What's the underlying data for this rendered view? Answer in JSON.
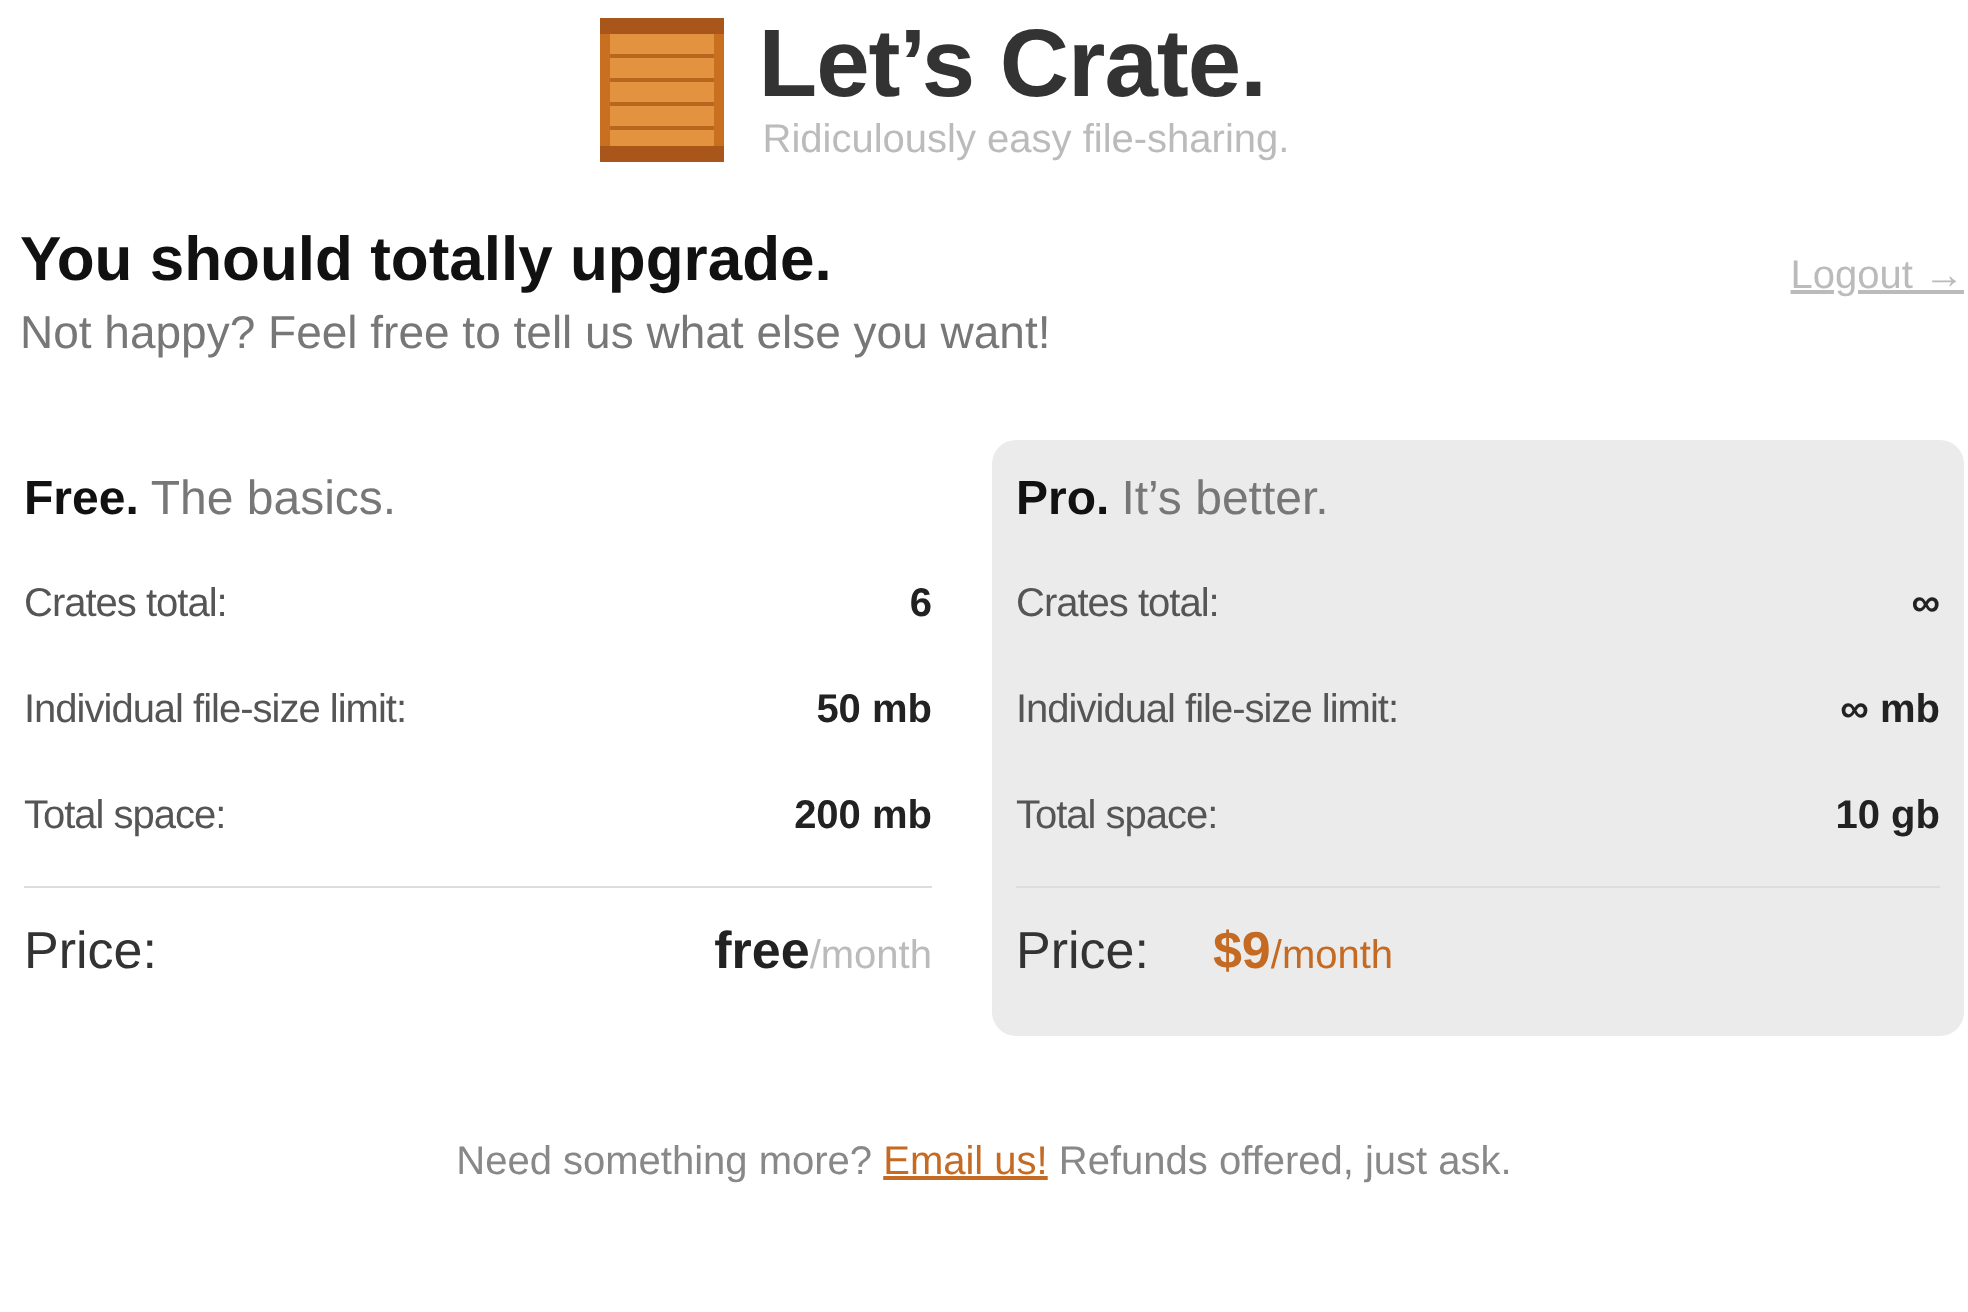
{
  "brand": {
    "title": "Let’s Crate.",
    "tagline": "Ridiculously easy file-sharing."
  },
  "header": {
    "heading": "You should totally upgrade.",
    "subheading": "Not happy? Feel free to tell us what else you want!",
    "logout": "Logout →"
  },
  "plans": [
    {
      "name": "Free.",
      "tagline": "The basics.",
      "highlighted": false,
      "features": [
        {
          "label": "Crates total:",
          "value": "6"
        },
        {
          "label": "Individual file-size limit:",
          "value": "50 mb"
        },
        {
          "label": "Total space:",
          "value": "200 mb"
        }
      ],
      "price_label": "Price:",
      "price": "free",
      "period": "/month"
    },
    {
      "name": "Pro.",
      "tagline": "It’s better.",
      "highlighted": true,
      "features": [
        {
          "label": "Crates total:",
          "value": "∞"
        },
        {
          "label": "Individual file-size limit:",
          "value": "∞ mb"
        },
        {
          "label": "Total space:",
          "value": "10 gb"
        }
      ],
      "price_label": "Price:",
      "price": "$9",
      "period": "/month"
    }
  ],
  "footer": {
    "before": "Need something more?",
    "link": "Email us!",
    "after": "Refunds offered, just ask."
  }
}
